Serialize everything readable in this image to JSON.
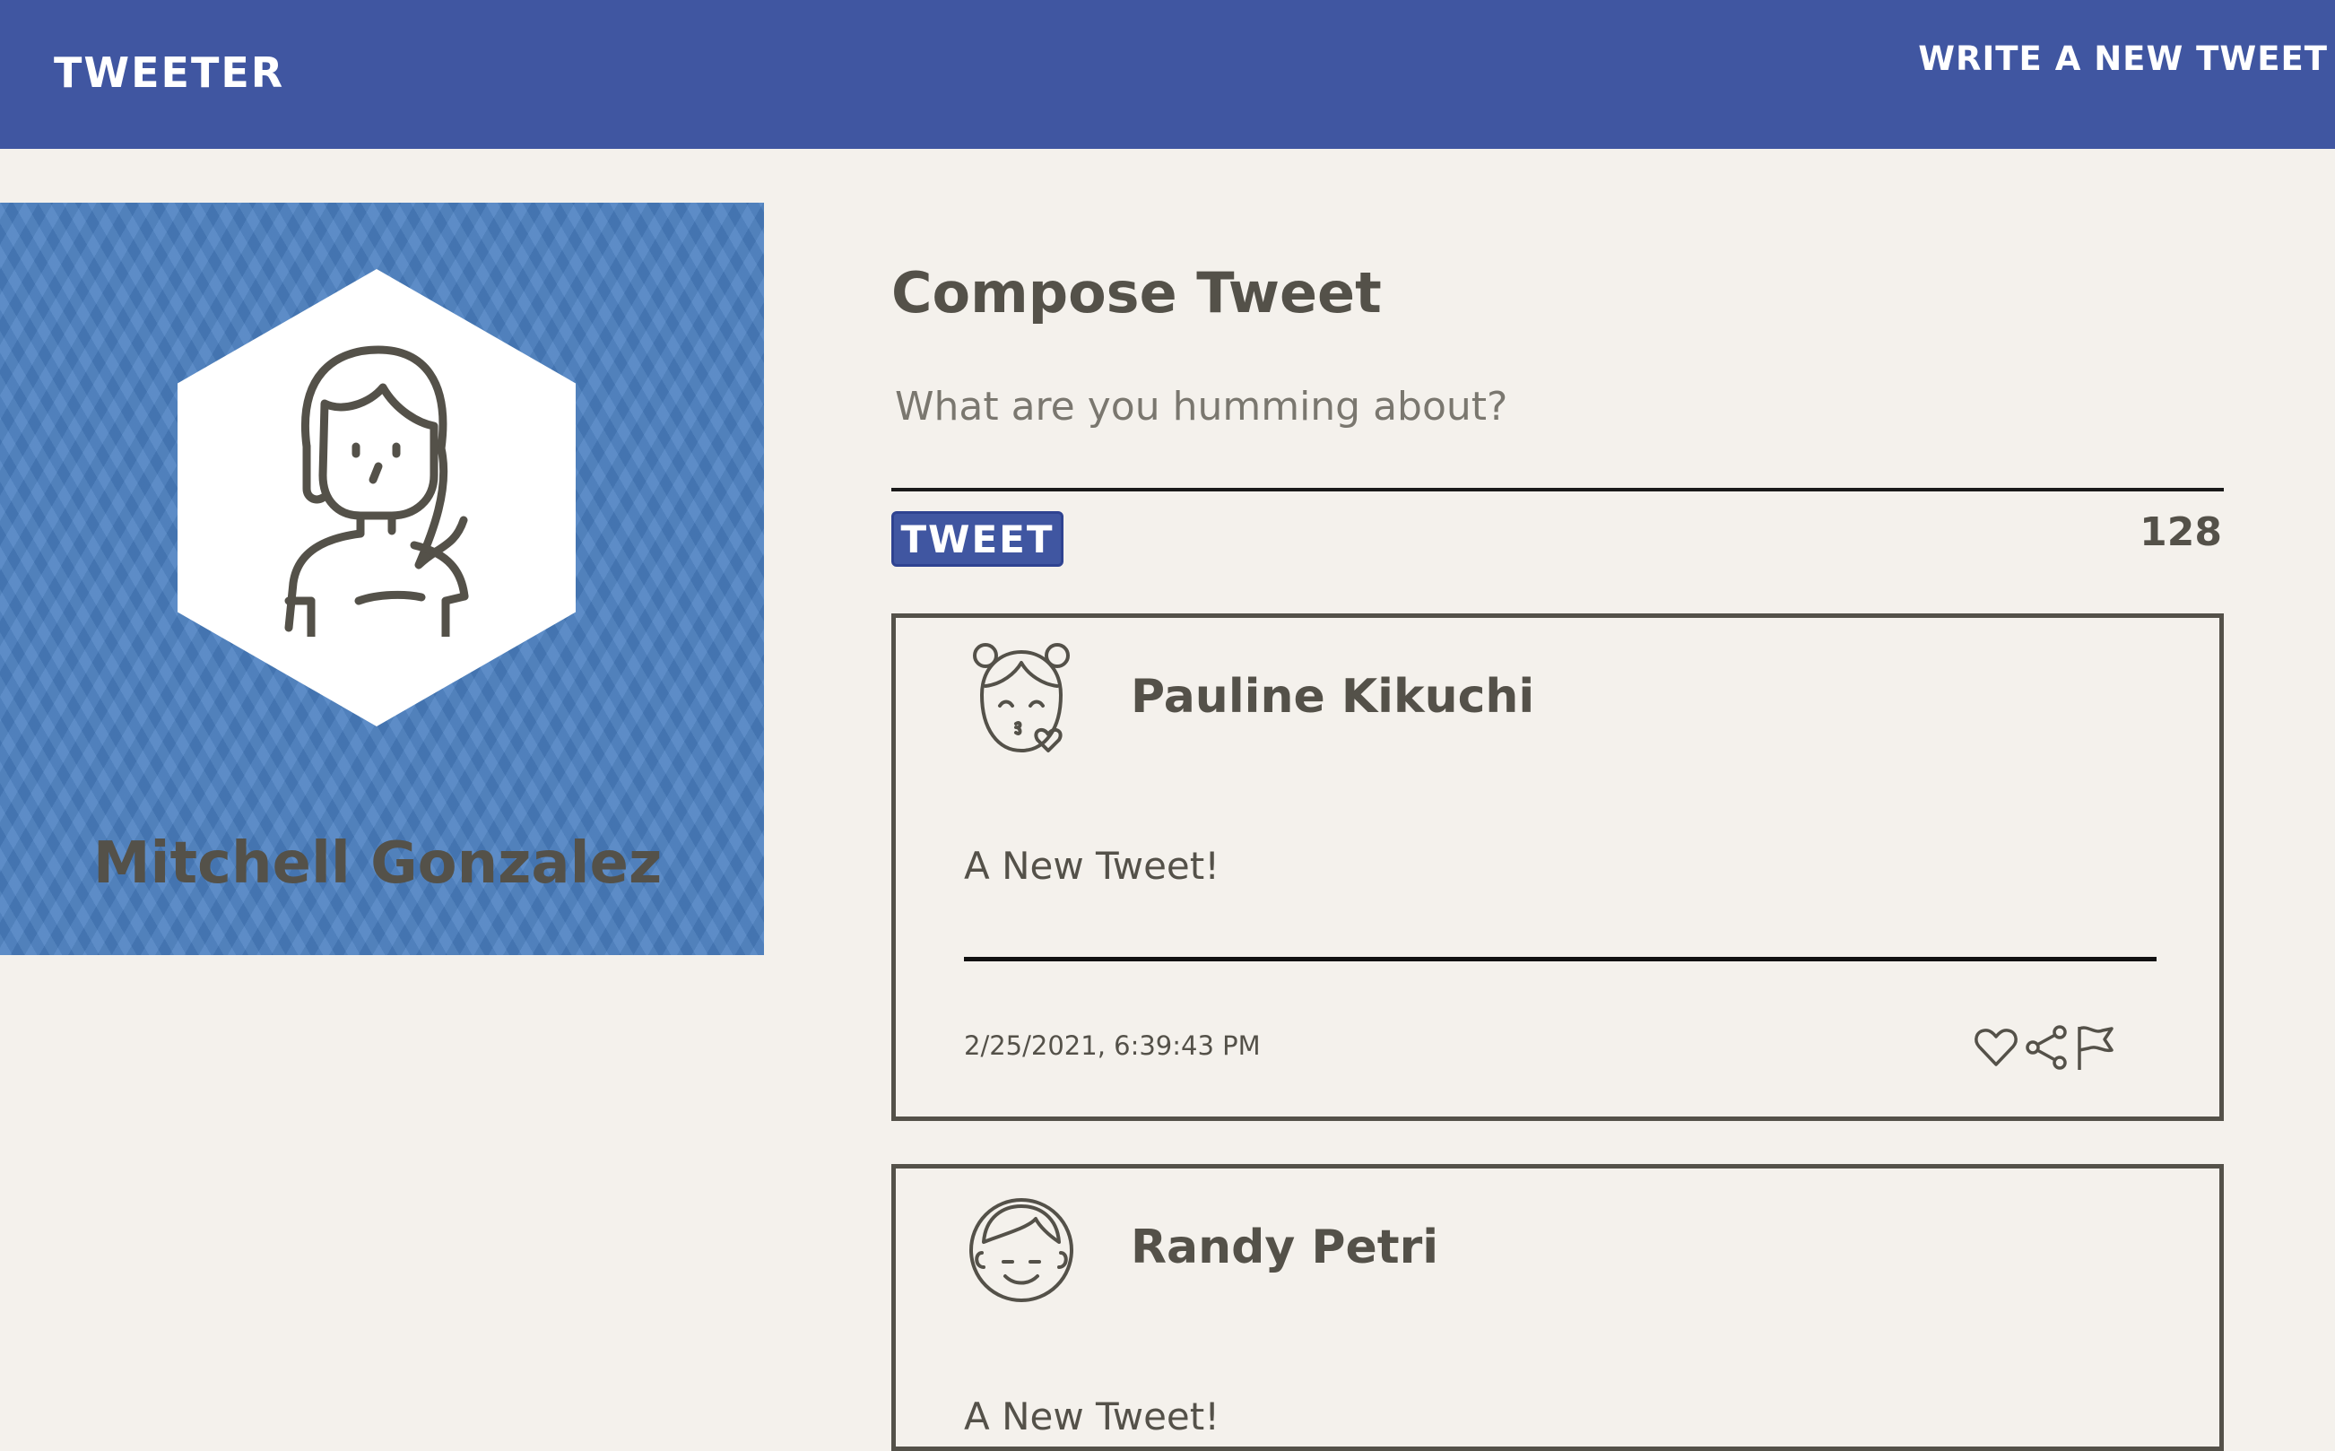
{
  "nav": {
    "brand": "TWEETER",
    "new_tweet_link": "WRITE A NEW TWEET"
  },
  "profile": {
    "name": "Mitchell Gonzalez",
    "avatar_icon": "user-avatar-icon",
    "background_color": "#4a7fc1"
  },
  "compose": {
    "title": "Compose Tweet",
    "placeholder": "What are you humming about?",
    "value": "",
    "submit_label": "TWEET",
    "char_counter": "128"
  },
  "tweets": [
    {
      "author": "Pauline Kikuchi",
      "avatar_icon": "kiss-face-avatar-icon",
      "body": "A New Tweet!",
      "timestamp": "2/25/2021, 6:39:43 PM",
      "actions": [
        "heart-icon",
        "share-icon",
        "flag-icon"
      ]
    },
    {
      "author": "Randy Petri",
      "avatar_icon": "smiling-man-avatar-icon",
      "body": "A New Tweet!"
    }
  ],
  "colors": {
    "accent": "#4056a1",
    "page_background": "#f4f1ec",
    "text": "#545149"
  }
}
